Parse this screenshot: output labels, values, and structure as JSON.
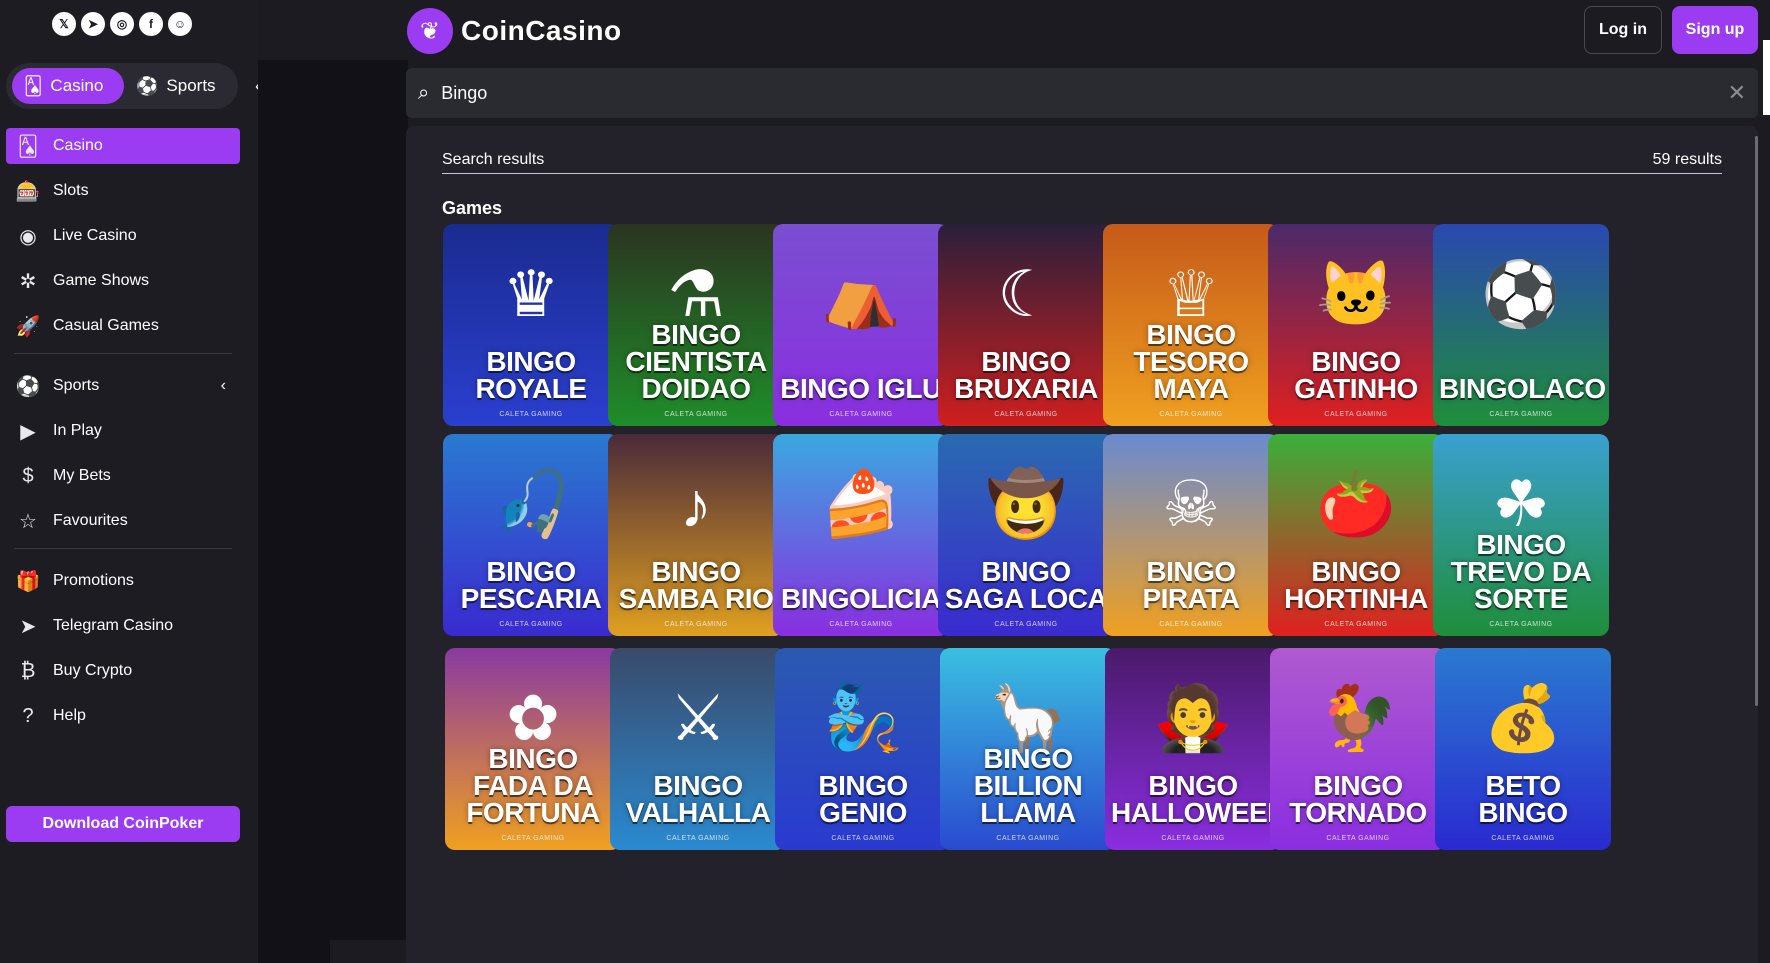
{
  "header": {
    "brand": "CoinCasino",
    "login_label": "Log in",
    "signup_label": "Sign up"
  },
  "social_icons": [
    "x-icon",
    "telegram-icon",
    "instagram-icon",
    "facebook-icon",
    "discord-icon"
  ],
  "mode_switch": {
    "casino_label": "Casino",
    "sports_label": "Sports"
  },
  "sidebar": {
    "casino_items": [
      {
        "label": "Casino",
        "icon": "casino-icon",
        "active": true
      },
      {
        "label": "Slots",
        "icon": "slot-machine-icon"
      },
      {
        "label": "Live Casino",
        "icon": "chip-icon"
      },
      {
        "label": "Game Shows",
        "icon": "wheel-icon"
      },
      {
        "label": "Casual Games",
        "icon": "rocket-icon"
      }
    ],
    "sports_items": [
      {
        "label": "Sports",
        "icon": "sports-icon"
      },
      {
        "label": "In Play",
        "icon": "play-icon"
      },
      {
        "label": "My Bets",
        "icon": "bets-icon"
      },
      {
        "label": "Favourites",
        "icon": "star-icon"
      }
    ],
    "other_items": [
      {
        "label": "Promotions",
        "icon": "gift-icon"
      },
      {
        "label": "Telegram Casino",
        "icon": "telegram-icon"
      },
      {
        "label": "Buy Crypto",
        "icon": "bitcoin-icon"
      },
      {
        "label": "Help",
        "icon": "help-icon"
      }
    ],
    "download_label": "Download CoinPoker"
  },
  "search": {
    "value": "Bingo"
  },
  "results": {
    "heading": "Search results",
    "count": "59 results",
    "section_title": "Games",
    "games": [
      {
        "title": "BINGO ROYALE",
        "provider": "CALETA GAMING",
        "colors": [
          "#1a2b8f",
          "#2b3fd0"
        ]
      },
      {
        "title": "BINGO CIENTISTA DOIDAO",
        "provider": "CALETA GAMING",
        "colors": [
          "#2b3420",
          "#1f8e2a"
        ]
      },
      {
        "title": "BINGO IGLU",
        "provider": "CALETA GAMING",
        "colors": [
          "#7a4fd0",
          "#8a2ee0"
        ]
      },
      {
        "title": "BINGO BRUXARIA",
        "provider": "CALETA GAMING",
        "colors": [
          "#2a1f3a",
          "#d01f1f"
        ]
      },
      {
        "title": "BINGO TESORO MAYA",
        "provider": "CALETA GAMING",
        "colors": [
          "#c65a1a",
          "#f0a020"
        ]
      },
      {
        "title": "BINGO GATINHO",
        "provider": "CALETA GAMING",
        "colors": [
          "#4a2a6a",
          "#e0201f"
        ]
      },
      {
        "title": "BINGOLACO",
        "provider": "CALETA GAMING",
        "colors": [
          "#2a48b0",
          "#1f8e3a"
        ]
      },
      {
        "title": "BINGO PESCARIA",
        "provider": "CALETA GAMING",
        "colors": [
          "#2a7ad0",
          "#3a2ad0"
        ]
      },
      {
        "title": "BINGO SAMBA RIO",
        "provider": "CALETA GAMING",
        "colors": [
          "#4a2a3a",
          "#e0a020"
        ]
      },
      {
        "title": "BINGOLICIA",
        "provider": "CALETA GAMING",
        "colors": [
          "#3aa8e0",
          "#8a2ee0"
        ]
      },
      {
        "title": "BINGO SAGA LOCA",
        "provider": "CALETA GAMING",
        "colors": [
          "#2a6ab0",
          "#3a2ad0"
        ]
      },
      {
        "title": "BINGO PIRATA",
        "provider": "CALETA GAMING",
        "colors": [
          "#6a8ad0",
          "#f0a020"
        ]
      },
      {
        "title": "BINGO HORTINHA",
        "provider": "CALETA GAMING",
        "colors": [
          "#3ab03a",
          "#e0201f"
        ]
      },
      {
        "title": "BINGO TREVO DA SORTE",
        "provider": "CALETA GAMING",
        "colors": [
          "#3aa0d0",
          "#1f8e3a"
        ]
      },
      {
        "title": "BINGO FADA DA FORTUNA",
        "provider": "CALETA GAMING",
        "colors": [
          "#8a3aa0",
          "#f0a020"
        ]
      },
      {
        "title": "BINGO VALHALLA",
        "provider": "CALETA GAMING",
        "colors": [
          "#3a4a6a",
          "#2a8ad0"
        ]
      },
      {
        "title": "BINGO GENIO",
        "provider": "CALETA GAMING",
        "colors": [
          "#2a5ab0",
          "#2a3ad0"
        ]
      },
      {
        "title": "BINGO BILLION LLAMA",
        "provider": "CALETA GAMING",
        "colors": [
          "#3ac0e0",
          "#2a4ad0"
        ]
      },
      {
        "title": "BINGO HALLOWEEN",
        "provider": "CALETA GAMING",
        "colors": [
          "#4a1a6a",
          "#8a2ee0"
        ]
      },
      {
        "title": "BINGO TORNADO",
        "provider": "CALETA GAMING",
        "colors": [
          "#b05ad0",
          "#8a2ee0"
        ]
      },
      {
        "title": "BETO BINGO",
        "provider": "CALETA GAMING",
        "colors": [
          "#2a7ad0",
          "#2a2ad0"
        ]
      }
    ]
  }
}
